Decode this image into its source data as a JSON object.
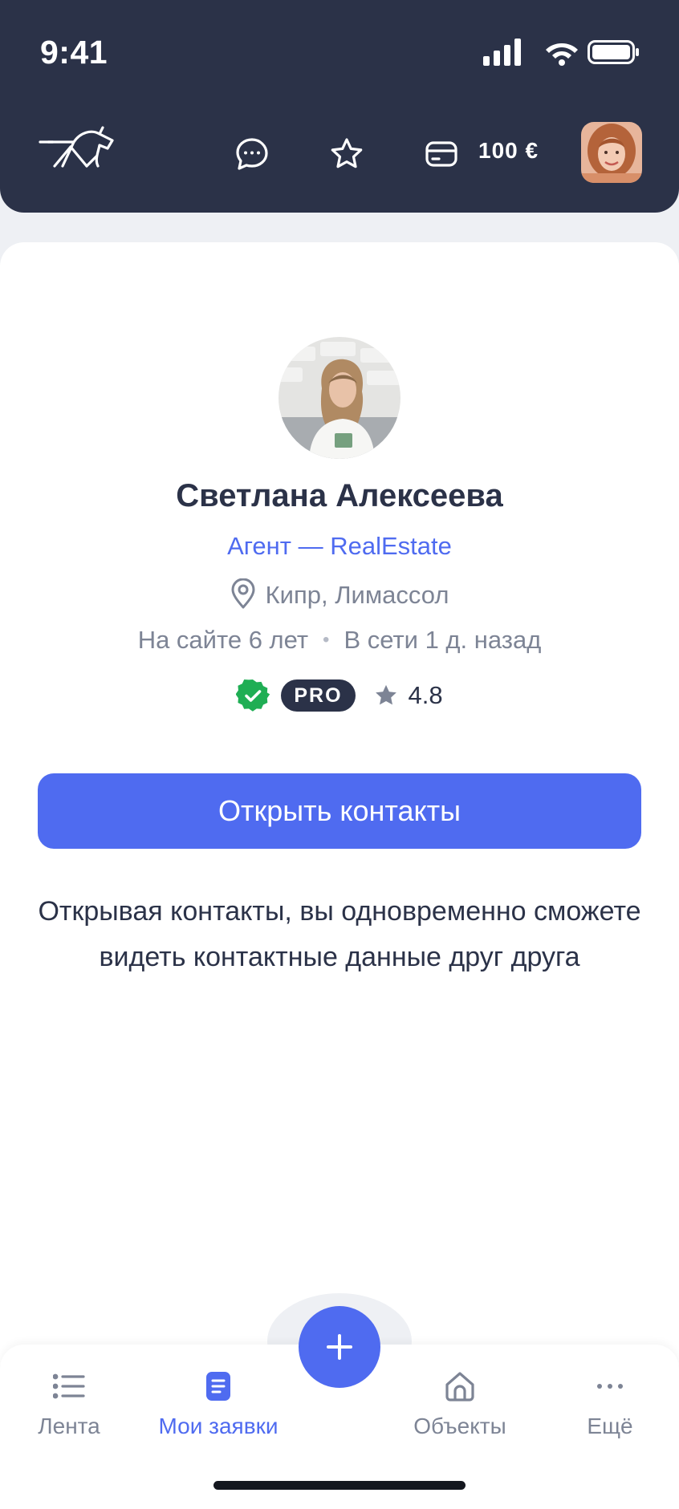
{
  "status_bar": {
    "time": "9:41"
  },
  "header": {
    "logo_icon": "unicorn-logo-icon",
    "chat_icon": "chat-icon",
    "favorites_icon": "star-outline-icon",
    "wallet_icon": "card-icon",
    "balance": "100 €"
  },
  "profile": {
    "name": "Светлана Алексеева",
    "role": "Агент — RealEstate",
    "location": "Кипр, Лимассол",
    "on_site": "На сайте 6 лет",
    "online": "В сети 1 д. назад",
    "verified_icon": "verified-check-icon",
    "pro_badge": "PRO",
    "rating": "4.8"
  },
  "actions": {
    "open_contacts": "Открыть контакты",
    "hint": "Открывая контакты, вы одновременно сможете видеть контактные данные друг друга"
  },
  "bottom_nav": {
    "items": [
      {
        "label": "Лента",
        "icon": "list-icon",
        "active": false
      },
      {
        "label": "Мои заявки",
        "icon": "document-icon",
        "active": true
      },
      {
        "label": "Объекты",
        "icon": "home-icon",
        "active": false
      },
      {
        "label": "Ещё",
        "icon": "more-dots-icon",
        "active": false
      }
    ],
    "fab_icon": "plus-icon"
  },
  "colors": {
    "header_bg": "#2b3248",
    "accent": "#4f6bf0",
    "muted_text": "#7d8495",
    "verified": "#1fae54"
  }
}
